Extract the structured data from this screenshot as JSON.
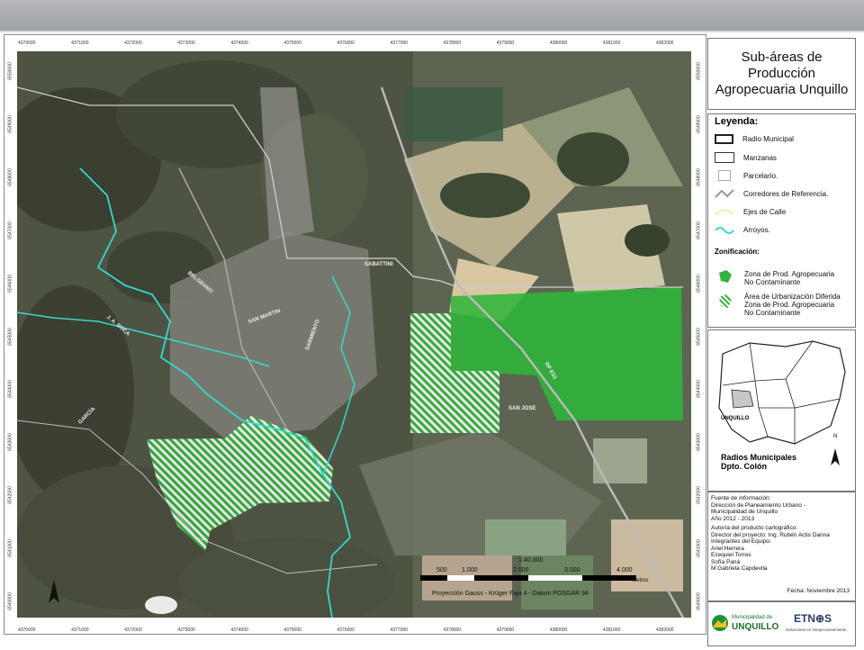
{
  "map": {
    "title": "Sub-áreas de Producción Agropecuaria Unquillo",
    "top_ticks": [
      "4370000",
      "4371000",
      "4372000",
      "4373000",
      "4374000",
      "4375000",
      "4376000",
      "4377000",
      "4378000",
      "4379000",
      "4380000",
      "4381000",
      "4382000"
    ],
    "bottom_ticks": [
      "4370000",
      "4371000",
      "4372000",
      "4373000",
      "4374000",
      "4375000",
      "4376000",
      "4377000",
      "4378000",
      "4379000",
      "4380000",
      "4381000",
      "4382000"
    ],
    "left_ticks": [
      "6550000",
      "6549000",
      "6548000",
      "6547000",
      "6546000",
      "6545000",
      "6544000",
      "6543000",
      "6542000",
      "6541000",
      "6540000"
    ],
    "right_ticks": [
      "6550000",
      "6549000",
      "6548000",
      "6547000",
      "6546000",
      "6545000",
      "6544000",
      "6543000",
      "6542000",
      "6541000",
      "6540000"
    ],
    "scale": {
      "ratio": "1:40.000",
      "labels": [
        "500",
        "1.000",
        "2.000",
        "3.000",
        "4.000"
      ],
      "unit": "Metros"
    },
    "projection": "Proyección Gauss - Krüger Faja 4 - Datum POSGAR 94",
    "street_labels": [
      "SABATTINI",
      "SAN JOSE",
      "RP E53",
      "BELGRANO",
      "J. A. ROCA",
      "SARMIENTO",
      "SAN MARTIN",
      "GARCÍA"
    ]
  },
  "legend": {
    "heading": "Leyenda:",
    "items": [
      {
        "label": "Radio Municipal"
      },
      {
        "label": "Manzanas"
      },
      {
        "label": "Parcelario."
      },
      {
        "label": "Corredores de Referencia."
      },
      {
        "label": "Ejes de Calle"
      },
      {
        "label": "Arroyos."
      }
    ],
    "zoning_heading": "Zonificación:",
    "zones": [
      {
        "line1": "Zona de Prod. Agropecuaria",
        "line2": "No Contaminante"
      },
      {
        "line1": "Área de Urbanización Diferida",
        "line2": "Zona de Prod. Agropecuaria",
        "line3": "No Contaminante"
      }
    ],
    "colors": {
      "solid_zone": "#2fb53a",
      "hatched_zone": "#2fb53a",
      "river": "#35d7d0"
    }
  },
  "locator": {
    "highlight": "UNQUILLO",
    "line1": "Radios Municipales",
    "line2": "Dpto. Colón",
    "north": "N"
  },
  "source": {
    "lines_1": [
      "Fuente de información:",
      "Dirección de Planeamiento Urbano -",
      "Municipalidad de Unquillo",
      "Año 2012 - 2013"
    ],
    "lines_2": [
      "Autoría del producto cartográfico:",
      "Director del proyecto: Ing. Rubén Actis Danna",
      "Integrantes del Equipo:",
      "Ariel Herrera",
      "Ezequiel Torres",
      "Sofía Paná",
      "M.Gabriela Capdevila"
    ],
    "date": "Fecha: Noviembre 2013"
  },
  "logos": {
    "municipality_small": "Municipalidad de",
    "municipality": "UNQUILLO",
    "company": "ETN⊕S",
    "company_tag": "Soluciones en Geoprocesamiento"
  }
}
